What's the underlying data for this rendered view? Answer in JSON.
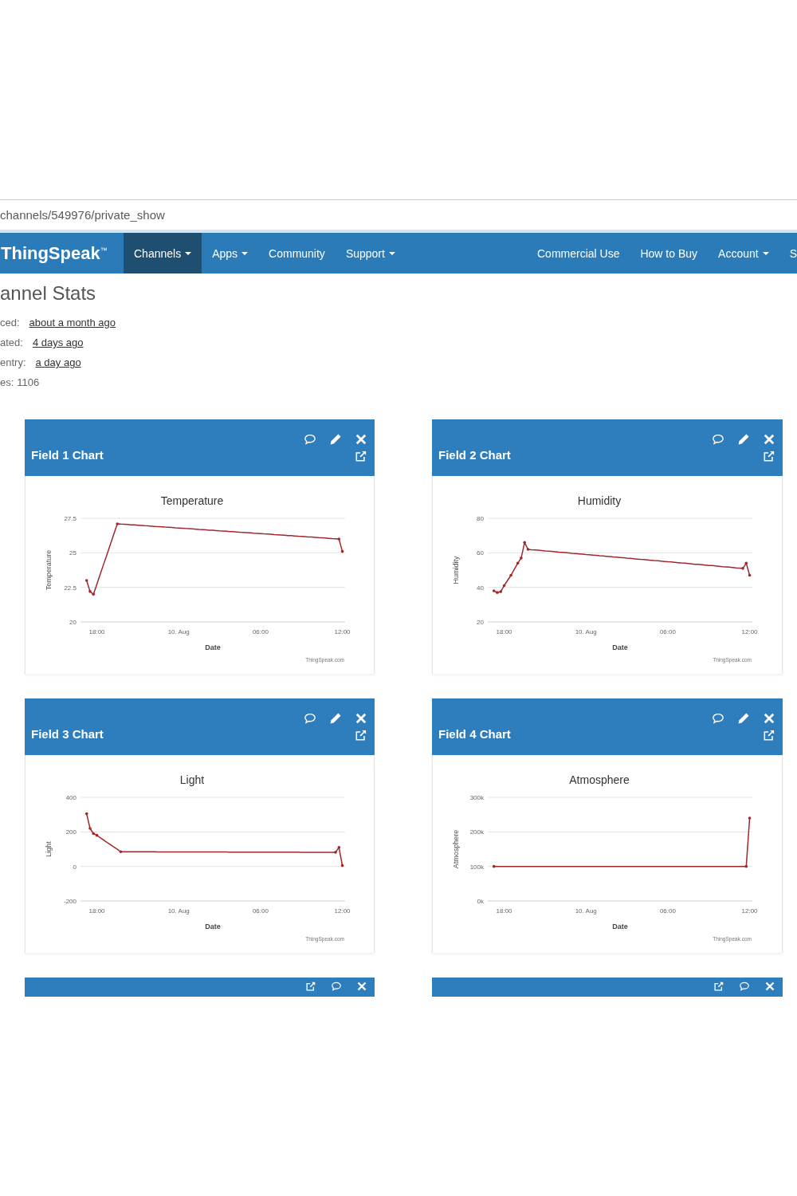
{
  "address_bar": {
    "url": "channels/549976/private_show"
  },
  "navbar": {
    "logo": "ThingSpeak$^{™}$",
    "items": [
      {
        "label": "Channels",
        "selected": true,
        "caret": true
      },
      {
        "label": "Apps",
        "selected": false,
        "caret": true
      },
      {
        "label": "Community",
        "selected": false,
        "caret": false
      },
      {
        "label": "Support",
        "selected": false,
        "caret": true
      }
    ],
    "right_items": [
      {
        "label": "Commercial Use",
        "selected": false,
        "caret": false
      },
      {
        "label": "How to Buy",
        "selected": false,
        "caret": false
      },
      {
        "label": "Account",
        "selected": false,
        "caret": true
      },
      {
        "label": "S",
        "selected": false,
        "caret": false
      }
    ]
  },
  "stats": {
    "heading": "annel Stats",
    "rows": [
      {
        "label": "ced:",
        "value": "about a month ago",
        "kind": "link"
      },
      {
        "label": "ated:",
        "value": "4 days ago",
        "kind": "link"
      },
      {
        "label": "entry:",
        "value": "a day ago",
        "kind": "link"
      },
      {
        "label": "es:",
        "value": "1106",
        "kind": "text"
      }
    ]
  },
  "panels": [
    {
      "kind": "chart",
      "title": "Field 1 Chart",
      "credit": "ThingSpeak.com",
      "chart_data": {
        "type": "line",
        "title": "Temperature",
        "xlabel": "Date",
        "ylabel": "Temperature",
        "categories": [
          null,
          null,
          null,
          null,
          "18:00",
          null,
          null,
          null,
          null,
          null,
          null,
          null,
          null,
          null,
          null,
          null,
          null,
          null,
          null,
          null,
          null,
          null,
          null,
          null,
          null,
          null,
          null,
          null,
          "10. Aug",
          null,
          null,
          null,
          null,
          null,
          null,
          null,
          null,
          null,
          null,
          null,
          null,
          null,
          null,
          null,
          null,
          null,
          null,
          null,
          null,
          null,
          null,
          null,
          "06:00",
          null,
          null,
          null,
          null,
          null,
          null,
          null,
          null,
          null,
          null,
          null,
          null,
          null,
          null,
          null,
          null,
          null,
          null,
          null,
          null,
          null,
          null,
          null,
          "12:00"
        ],
        "series": [
          {
            "color": "#a0282d",
            "values": [
              null,
              23.0,
              22.2,
              22.0,
              22.73,
              23.46,
              24.19,
              24.91,
              25.64,
              26.37,
              27.1,
              27.08,
              27.07,
              27.05,
              27.03,
              27.02,
              27.0,
              26.98,
              26.96,
              26.95,
              26.93,
              26.91,
              26.9,
              26.88,
              26.86,
              26.85,
              26.83,
              26.81,
              26.8,
              26.78,
              26.76,
              26.75,
              26.73,
              26.71,
              26.69,
              26.68,
              26.66,
              26.64,
              26.63,
              26.61,
              26.59,
              26.58,
              26.56,
              26.54,
              26.53,
              26.51,
              26.49,
              26.48,
              26.46,
              26.44,
              26.42,
              26.41,
              26.39,
              26.37,
              26.36,
              26.34,
              26.32,
              26.31,
              26.29,
              26.27,
              26.25,
              26.24,
              26.22,
              26.2,
              26.19,
              26.17,
              26.15,
              26.14,
              26.12,
              26.1,
              26.09,
              26.07,
              26.05,
              26.03,
              26.02,
              26.0,
              25.1
            ]
          }
        ],
        "ylim": [
          20,
          27.5
        ],
        "yticks": [
          20,
          22.5,
          25,
          27.5
        ]
      }
    },
    {
      "kind": "chart",
      "title": "Field 2 Chart",
      "credit": "ThingSpeak.com",
      "chart_data": {
        "type": "line",
        "title": "Humidity",
        "xlabel": "Date",
        "ylabel": "Humidity",
        "categories": [
          null,
          null,
          null,
          null,
          "18:00",
          null,
          null,
          null,
          null,
          null,
          null,
          null,
          null,
          null,
          null,
          null,
          null,
          null,
          null,
          null,
          null,
          null,
          null,
          null,
          null,
          null,
          null,
          null,
          "10. Aug",
          null,
          null,
          null,
          null,
          null,
          null,
          null,
          null,
          null,
          null,
          null,
          null,
          null,
          null,
          null,
          null,
          null,
          null,
          null,
          null,
          null,
          null,
          null,
          "06:00",
          null,
          null,
          null,
          null,
          null,
          null,
          null,
          null,
          null,
          null,
          null,
          null,
          null,
          null,
          null,
          null,
          null,
          null,
          null,
          null,
          null,
          null,
          null,
          "12:00"
        ],
        "series": [
          {
            "color": "#a0282d",
            "values": [
              null,
              38,
              37,
              37.5,
              41,
              44,
              47,
              50.5,
              54,
              57,
              66,
              62,
              61.8,
              61.7,
              61.5,
              61.3,
              61.1,
              61.0,
              60.8,
              60.6,
              60.4,
              60.3,
              60.1,
              59.9,
              59.7,
              59.6,
              59.4,
              59.2,
              59.0,
              58.9,
              58.7,
              58.5,
              58.3,
              58.2,
              58.0,
              57.8,
              57.6,
              57.5,
              57.3,
              57.1,
              56.9,
              56.8,
              56.6,
              56.4,
              56.2,
              56.1,
              55.9,
              55.7,
              55.5,
              55.4,
              55.2,
              55.0,
              54.8,
              54.7,
              54.5,
              54.3,
              54.1,
              54.0,
              53.8,
              53.6,
              53.4,
              53.3,
              53.1,
              52.9,
              52.7,
              52.6,
              52.4,
              52.2,
              52.0,
              51.9,
              51.7,
              51.5,
              51.3,
              51.2,
              51.0,
              54,
              47
            ]
          }
        ],
        "ylim": [
          20,
          80
        ],
        "yticks": [
          20,
          40,
          60,
          80
        ]
      }
    },
    {
      "kind": "chart",
      "title": "Field 3 Chart",
      "credit": "ThingSpeak.com",
      "chart_data": {
        "type": "line",
        "title": "Light",
        "xlabel": "Date",
        "ylabel": "Light",
        "categories": [
          null,
          null,
          null,
          null,
          "18:00",
          null,
          null,
          null,
          null,
          null,
          null,
          null,
          null,
          null,
          null,
          null,
          null,
          null,
          null,
          null,
          null,
          null,
          null,
          null,
          null,
          null,
          null,
          null,
          "10. Aug",
          null,
          null,
          null,
          null,
          null,
          null,
          null,
          null,
          null,
          null,
          null,
          null,
          null,
          null,
          null,
          null,
          null,
          null,
          null,
          null,
          null,
          null,
          null,
          "06:00",
          null,
          null,
          null,
          null,
          null,
          null,
          null,
          null,
          null,
          null,
          null,
          null,
          null,
          null,
          null,
          null,
          null,
          null,
          null,
          null,
          null,
          null,
          null,
          "12:00"
        ],
        "series": [
          {
            "color": "#a0282d",
            "values": [
              null,
              305,
              220,
              190,
              180,
              166,
              153,
              139,
              126,
              112,
              99,
              85,
              85,
              85,
              85,
              85,
              85,
              85,
              85,
              85,
              85,
              85,
              84,
              84,
              84,
              84,
              84,
              84,
              84,
              84,
              84,
              84,
              84,
              84,
              84,
              84,
              84,
              84,
              84,
              84,
              84,
              84,
              84,
              83,
              83,
              83,
              83,
              83,
              83,
              83,
              83,
              83,
              83,
              83,
              83,
              83,
              83,
              83,
              83,
              83,
              83,
              83,
              83,
              83,
              82,
              82,
              82,
              82,
              82,
              82,
              82,
              82,
              82,
              82,
              82,
              110,
              5
            ]
          }
        ],
        "ylim": [
          -200,
          400
        ],
        "yticks": [
          -200,
          0,
          200,
          400
        ]
      }
    },
    {
      "kind": "chart",
      "title": "Field 4 Chart",
      "credit": "ThingSpeak.com",
      "chart_data": {
        "type": "line",
        "title": "Atmosphere",
        "xlabel": "Date",
        "ylabel": "Atmosphere",
        "categories": [
          null,
          null,
          null,
          null,
          "18:00",
          null,
          null,
          null,
          null,
          null,
          null,
          null,
          null,
          null,
          null,
          null,
          null,
          null,
          null,
          null,
          null,
          null,
          null,
          null,
          null,
          null,
          null,
          null,
          "10. Aug",
          null,
          null,
          null,
          null,
          null,
          null,
          null,
          null,
          null,
          null,
          null,
          null,
          null,
          null,
          null,
          null,
          null,
          null,
          null,
          null,
          null,
          null,
          null,
          "06:00",
          null,
          null,
          null,
          null,
          null,
          null,
          null,
          null,
          null,
          null,
          null,
          null,
          null,
          null,
          null,
          null,
          null,
          null,
          null,
          null,
          null,
          null,
          null,
          "12:00"
        ],
        "series": [
          {
            "color": "#a0282d",
            "values": [
              null,
              100000,
              100000,
              100000,
              100000,
              100000,
              100000,
              100000,
              100000,
              100000,
              100000,
              100000,
              100000,
              100000,
              100000,
              100000,
              100000,
              100000,
              100000,
              100000,
              100000,
              100000,
              100000,
              100000,
              100000,
              100000,
              100000,
              100000,
              100000,
              100000,
              100000,
              100000,
              100000,
              100000,
              100000,
              100000,
              100000,
              100000,
              100000,
              100000,
              100000,
              100000,
              100000,
              100000,
              100000,
              100000,
              100000,
              100000,
              100000,
              100000,
              100000,
              100000,
              100000,
              100000,
              100000,
              100000,
              100000,
              100000,
              100000,
              100000,
              100000,
              100000,
              100000,
              100000,
              100000,
              100000,
              100000,
              100000,
              100000,
              100000,
              100000,
              100000,
              100000,
              100000,
              100000,
              100000,
              240000
            ]
          }
        ],
        "ylim": [
          0,
          300000
        ],
        "yticks": [
          {
            "value": 0,
            "label": "0k"
          },
          {
            "value": 100000,
            "label": "100k"
          },
          {
            "value": 200000,
            "label": "200k"
          },
          {
            "value": 300000,
            "label": "300k"
          }
        ]
      }
    },
    {
      "kind": "collapsed"
    },
    {
      "kind": "collapsed"
    }
  ]
}
